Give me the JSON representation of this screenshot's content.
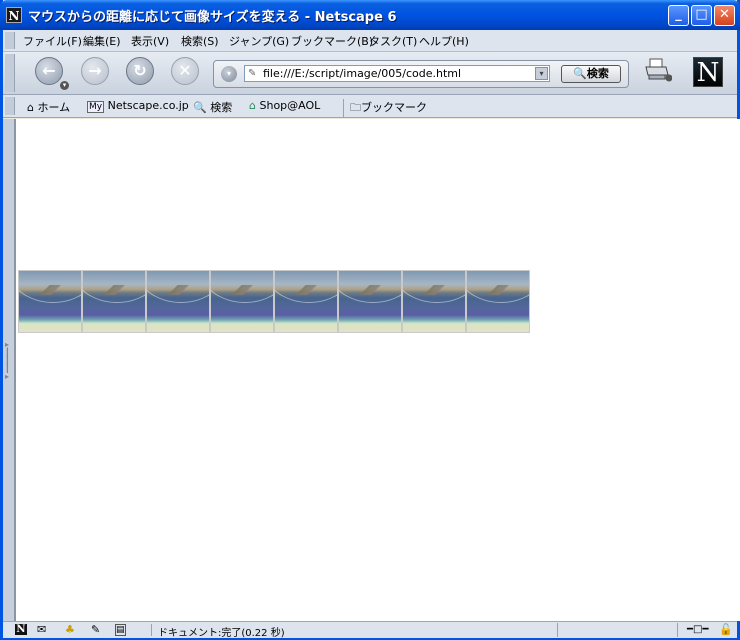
{
  "window": {
    "title": "マウスからの距離に応じて画像サイズを変える - Netscape 6",
    "app_icon_letter": "N",
    "minimize": "_",
    "maximize": "□",
    "close": "✕"
  },
  "menu": {
    "items": [
      "ファイル(F)",
      "編集(E)",
      "表示(V)",
      "検索(S)",
      "ジャンプ(G)",
      "ブックマーク(B)",
      "タスク(T)",
      "ヘルプ(H)"
    ]
  },
  "navigation": {
    "back_icon": "←",
    "forward_icon": "→",
    "reload_icon": "↻",
    "stop_icon": "✕",
    "url_value": "file:///E:/script/image/005/code.html",
    "search_label": "検索",
    "logo_letter": "N"
  },
  "personal_toolbar": {
    "items": [
      "ホーム",
      "Netscape.co.jp",
      "検索",
      "Shop@AOL",
      "ブックマーク"
    ],
    "my_badge": "My"
  },
  "content": {
    "thumbnail_count": 8,
    "thumbnail_name": "beach-landscape-thumbnail"
  },
  "status": {
    "text": "ドキュメント:完了(0.22 秒)"
  },
  "colors": {
    "title_bar": "#0053e1",
    "content_bg": "#ffffff",
    "chrome_bg": "#dde4ee"
  }
}
